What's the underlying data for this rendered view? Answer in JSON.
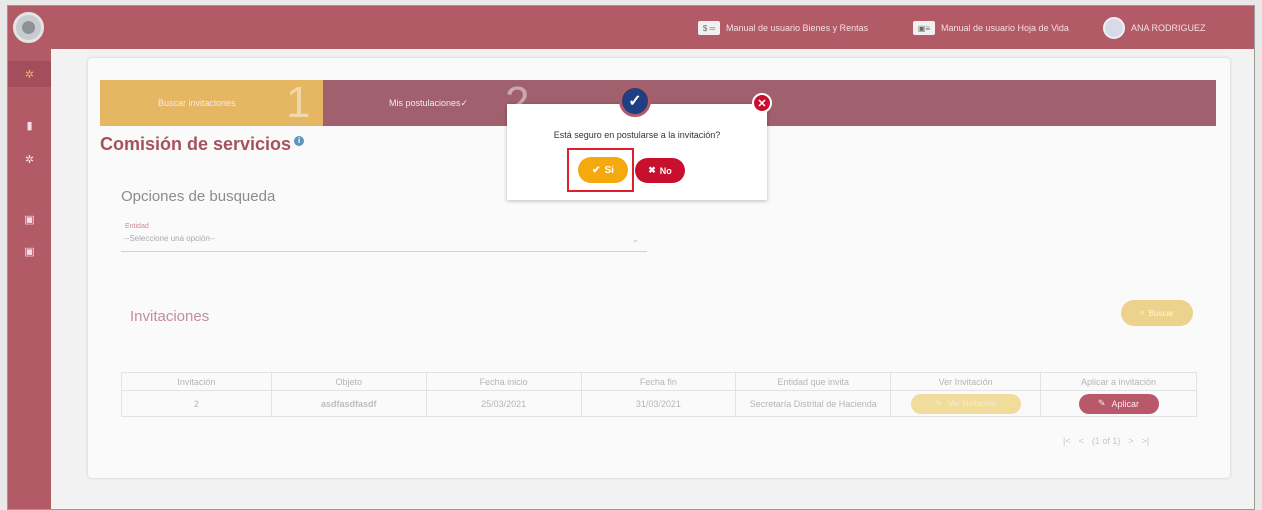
{
  "topbar": {
    "manual_bienes": "Manual de usuario Bienes y Rentas",
    "manual_hoja": "Manual de usuario Hoja de Vida",
    "user_name": "ANA RODRIGUEZ",
    "bienes_icon_text": "$ ═"
  },
  "steps": {
    "step1_label": "Buscar invitaciones",
    "step1_num": "1",
    "step2_label": "Mis postulaciones✓",
    "step2_num": "2"
  },
  "page": {
    "title": "Comisión de servicios",
    "info_icon": "i",
    "options_title": "Opciones de busqueda",
    "entity_label": "Entidad",
    "entity_value": "--Seleccione una opción--",
    "invitations_title": "Invitaciones",
    "search_label": "Buscar"
  },
  "table": {
    "headers": [
      "Invitación",
      "Objeto",
      "Fecha inicio",
      "Fecha fin",
      "Entidad que invita",
      "Ver Invitación",
      "Aplicar a invitación"
    ],
    "rows": [
      {
        "invitacion": "2",
        "objeto": "asdfasdfasdf",
        "fecha_inicio": "25/03/2021",
        "fecha_fin": "31/03/2021",
        "entidad": "Secretaría Distrital de Hacienda",
        "ver_label": "Ver invitación",
        "aplicar_label": "Aplicar"
      }
    ]
  },
  "pager": {
    "first": "|<",
    "prev": "<",
    "status": "(1 of 1)",
    "next": ">",
    "last": ">|"
  },
  "dialog": {
    "message": "Está seguro en postularse a la invitación?",
    "yes_label": "Si",
    "no_label": "No"
  },
  "colors": {
    "brand": "#b35a67",
    "accent": "#f4a90f",
    "danger": "#c8102e",
    "dialog_check": "#1f3f82"
  }
}
